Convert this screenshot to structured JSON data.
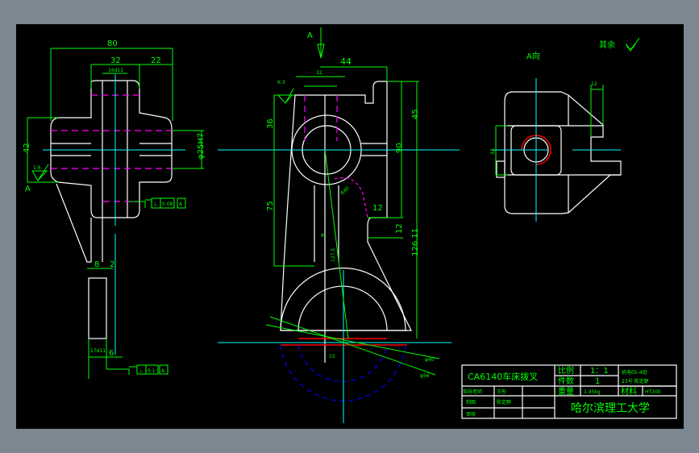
{
  "notes": {
    "view_label": "A向",
    "arrow_label": "A",
    "rest_roughness": "其余"
  },
  "left_view": {
    "dims": [
      "80",
      "32",
      "22",
      "16d11",
      "42",
      "φ25H7",
      "1.6",
      "8",
      "2",
      "6",
      "17d11"
    ],
    "tolerance_1": {
      "symbol": "⊥",
      "value": "0.08",
      "datum": "A"
    },
    "tolerance_2": {
      "symbol": "⊥",
      "value": "0.1",
      "datum": "A"
    },
    "datum": "A"
  },
  "front_view": {
    "dims": [
      "44",
      "32",
      "6.3",
      "36",
      "75",
      "45",
      "90",
      "12",
      "12",
      "126.11",
      "R40",
      "127.5",
      "8",
      "15",
      "φ40",
      "φ56"
    ]
  },
  "right_view": {
    "dims": [
      "12",
      "32"
    ]
  },
  "title_block": {
    "part_name": "CA6140车床拨叉",
    "scale_label": "比例",
    "scale_value": "1：1",
    "count_label": "件数",
    "count_value": "1",
    "weight_label": "重量",
    "weight_value": "1.45kg",
    "material_label": "材料",
    "material_value": "HT200",
    "class_line1": "机电05-4班",
    "class_line2": "23号 陈定野",
    "advisor_label": "指导老师",
    "advisor_name": "王彤",
    "drawn_label": "制图",
    "drawn_name": "陈定野",
    "review_label": "审核",
    "school": "哈尔滨理工大学"
  }
}
